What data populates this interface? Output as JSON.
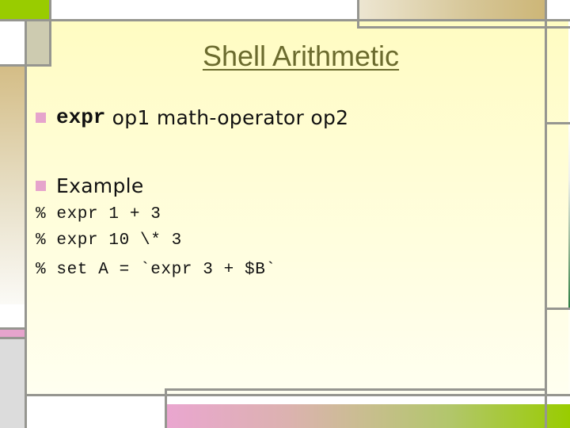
{
  "slide": {
    "title": "Shell Arithmetic",
    "bullets": [
      {
        "keyword": "expr",
        "text": " op1 math-operator op2"
      },
      {
        "text": "Example"
      }
    ],
    "code_lines": [
      {
        "prompt": "%",
        "command": "expr 1 + 3"
      },
      {
        "prompt": "%",
        "command": "expr 10 \\* 3"
      },
      {
        "prompt": "%",
        "command": "set A = `expr 3 + $B`"
      }
    ]
  },
  "colors": {
    "title": "#6b6b2e",
    "bullet": "#e6a4cc",
    "frame_lines": "#969690",
    "accent_green": "#99cc00",
    "panel_background": "#fffdd6"
  }
}
